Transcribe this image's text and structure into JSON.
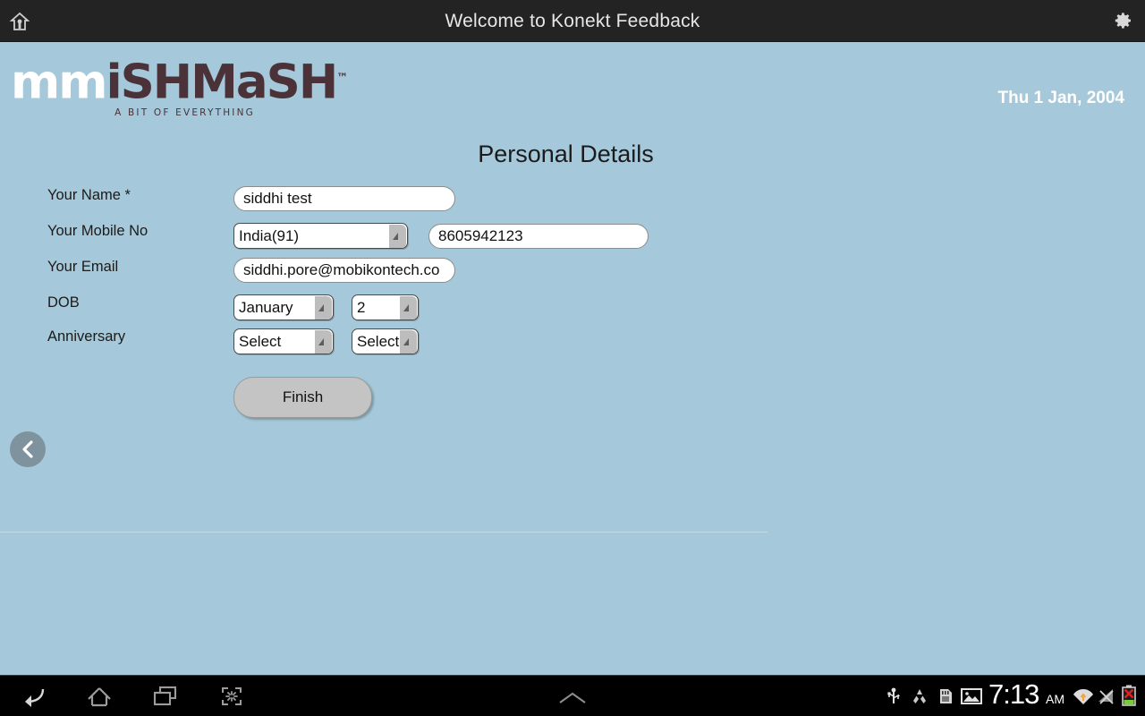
{
  "appbar": {
    "title": "Welcome to Konekt Feedback",
    "home_icon": "home-icon",
    "settings_icon": "gear-icon"
  },
  "header": {
    "logo_light": "mm",
    "logo_dark": "iSHMaSH",
    "logo_tm": "™",
    "tagline": "A BIT OF EVERYTHING",
    "date": "Thu 1 Jan, 2004"
  },
  "form": {
    "title": "Personal Details",
    "fields": [
      {
        "label": "Your Name *",
        "value": "siddhi test"
      },
      {
        "label": "Your Mobile No",
        "country_code": "India(91)",
        "number": "8605942123"
      },
      {
        "label": "Your Email",
        "value": "siddhi.pore@mobikontech.co"
      },
      {
        "label": "DOB",
        "month": "January",
        "day": "2"
      },
      {
        "label": "Anniversary",
        "month": "Select",
        "day": "Select"
      }
    ],
    "finish_label": "Finish",
    "back_icon": "chevron-left-icon"
  },
  "navbar": {
    "back_icon": "back-arrow-icon",
    "home_icon": "home-outline-icon",
    "recents_icon": "recent-apps-icon",
    "screenshot_icon": "screenshot-icon",
    "expand_icon": "chevron-up-icon"
  },
  "statusbar": {
    "usb_icon": "usb-icon",
    "recycle_icon": "recycle-icon",
    "sdcard_icon": "sd-card-icon",
    "photo_icon": "image-icon",
    "time": "7:13",
    "meridiem": "AM",
    "wifi_icon": "wifi-icon",
    "signal_icon": "no-signal-icon",
    "battery_icon": "battery-error-icon"
  },
  "colors": {
    "background": "#a5c9da",
    "appbar": "#232323",
    "logo_dark": "#4a3238",
    "navbar": "#000000",
    "button": "#c4c4c4",
    "back_circle": "#7f939e"
  }
}
